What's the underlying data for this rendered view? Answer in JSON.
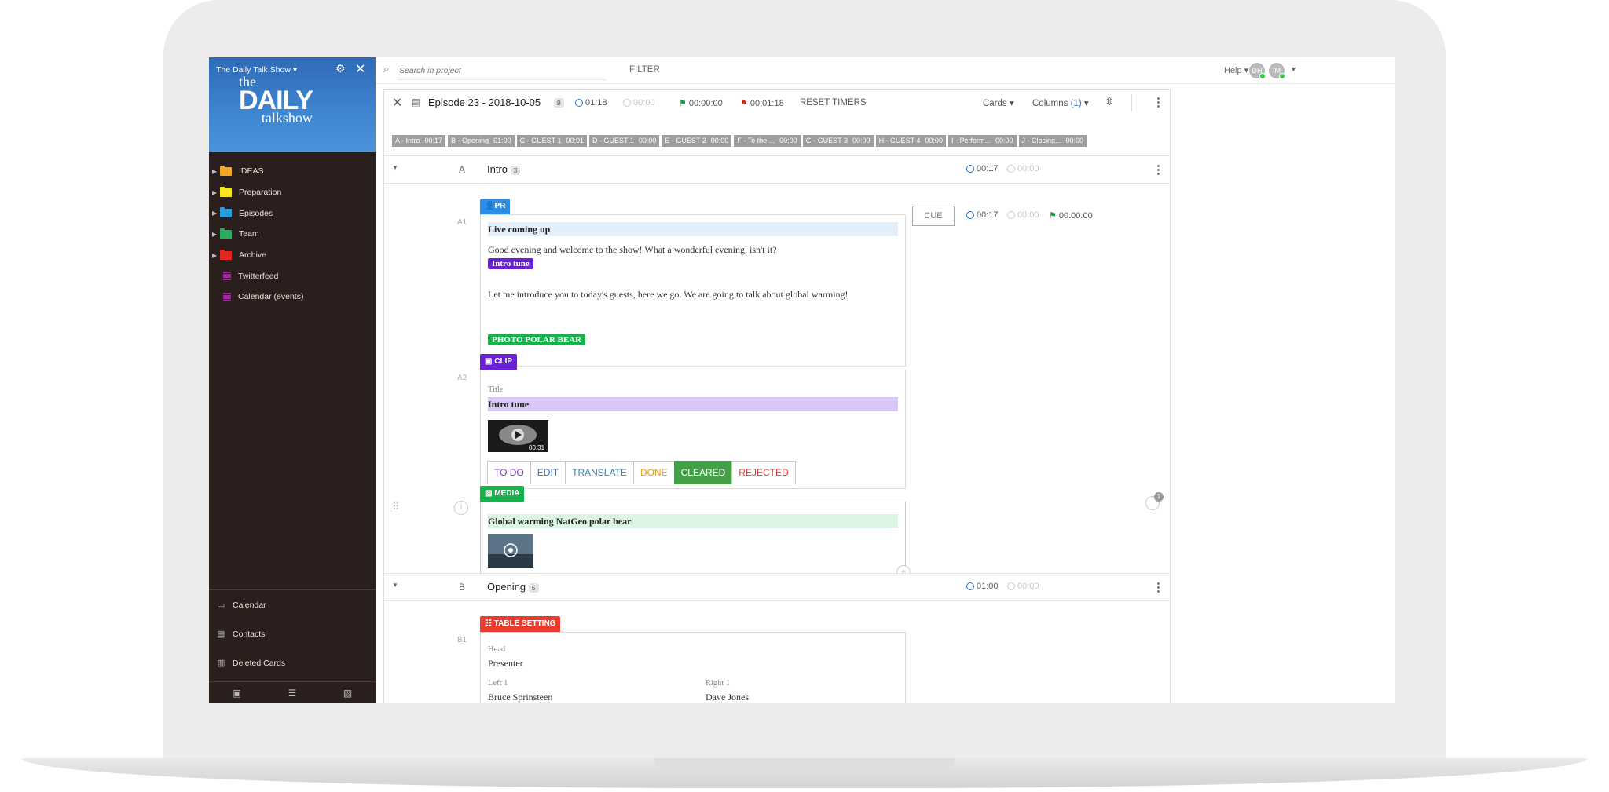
{
  "sidebar": {
    "project": "The Daily Talk Show ▾",
    "logo": {
      "the": "the",
      "daily": "DAILY",
      "talkshow": "talkshow"
    },
    "items": [
      {
        "label": "IDEAS",
        "color": "#f5a623",
        "kind": "folder"
      },
      {
        "label": "Preparation",
        "color": "#f8e71c",
        "kind": "folder"
      },
      {
        "label": "Episodes",
        "color": "#2d9cdb",
        "kind": "folder"
      },
      {
        "label": "Team",
        "color": "#27ae60",
        "kind": "folder"
      },
      {
        "label": "Archive",
        "color": "#e5261f",
        "kind": "folder"
      },
      {
        "label": "Twitterfeed",
        "color": "#b01cb0",
        "kind": "list"
      },
      {
        "label": "Calendar (events)",
        "color": "#b01cb0",
        "kind": "list"
      }
    ],
    "bottom_links": [
      {
        "label": "Calendar",
        "icon": "calendar-icon"
      },
      {
        "label": "Contacts",
        "icon": "contacts-icon"
      },
      {
        "label": "Deleted Cards",
        "icon": "trash-icon"
      }
    ]
  },
  "topbar": {
    "search_placeholder": "Search in project",
    "filter": "FILTER",
    "help": "Help ▾",
    "avatars": [
      "DH",
      "IM"
    ]
  },
  "episode": {
    "title": "Episode 23 - 2018-10-05",
    "count": "9",
    "planned": "01:18",
    "elapsed": "00:00",
    "start_flag": "00:00:00",
    "end_flag": "00:01:18",
    "reset": "RESET TIMERS",
    "cards_menu": "Cards ▾",
    "columns_menu": "Columns",
    "columns_count": "(1)",
    "chips": [
      {
        "label": "A - Intro",
        "time": "00:17"
      },
      {
        "label": "B - Opening",
        "time": "01:00"
      },
      {
        "label": "C - GUEST 1",
        "time": "00:01"
      },
      {
        "label": "D - GUEST 1",
        "time": "00:00"
      },
      {
        "label": "E - GUEST 2",
        "time": "00:00"
      },
      {
        "label": "F - To the ...",
        "time": "00:00"
      },
      {
        "label": "G - GUEST 3",
        "time": "00:00"
      },
      {
        "label": "H - GUEST 4",
        "time": "00:00"
      },
      {
        "label": "I - Perform...",
        "time": "00:00"
      },
      {
        "label": "J - Closing...",
        "time": "00:00"
      }
    ]
  },
  "sections": {
    "a": {
      "letter": "A",
      "title": "Intro",
      "count": "3",
      "planned": "00:17",
      "elapsed": "00:00"
    },
    "b": {
      "letter": "B",
      "title": "Opening",
      "count": "5",
      "planned": "01:00",
      "elapsed": "00:00"
    }
  },
  "cards": {
    "a1": {
      "row": "A1",
      "tag": "PR",
      "tag_color": "#2d8ee8",
      "headline": "Live coming up",
      "text1": "Good evening and welcome to the show!  What a wonderful evening, isn't it?",
      "pill1": "Intro tune",
      "text2": "Let me introduce you to today's guests, here we go. We are going to talk about global warming!",
      "pill2": "PHOTO POLAR BEAR",
      "cue": "CUE",
      "planned": "00:17",
      "elapsed": "00:00",
      "flag": "00:00:00"
    },
    "a2": {
      "row": "A2",
      "tag": "CLIP",
      "tag_color": "#6a1fd9",
      "title_label": "Title",
      "title": "Intro tune",
      "duration": "00:31",
      "statuses": [
        {
          "label": "TO DO",
          "color": "#7b3fbf",
          "bg": "#ffffff"
        },
        {
          "label": "EDIT",
          "color": "#2a6fc9",
          "bg": "#ffffff"
        },
        {
          "label": "TRANSLATE",
          "color": "#3a7fa8",
          "bg": "#ffffff"
        },
        {
          "label": "DONE",
          "color": "#e59a0e",
          "bg": "#ffffff"
        },
        {
          "label": "CLEARED",
          "color": "#ffffff",
          "bg": "#43a047"
        },
        {
          "label": "REJECTED",
          "color": "#e53935",
          "bg": "#ffffff"
        }
      ]
    },
    "a3": {
      "tag": "MEDIA",
      "tag_color": "#16b24b",
      "headline": "Global warming NatGeo polar bear",
      "comment_count": "1"
    },
    "b1": {
      "row": "B1",
      "tag": "TABLE SETTING",
      "tag_color": "#ea3b2e",
      "head_label": "Head",
      "head": "Presenter",
      "left_label": "Left 1",
      "left": "Bruce Sprinsteen",
      "right_label": "Right 1",
      "right": "Dave Jones"
    }
  }
}
